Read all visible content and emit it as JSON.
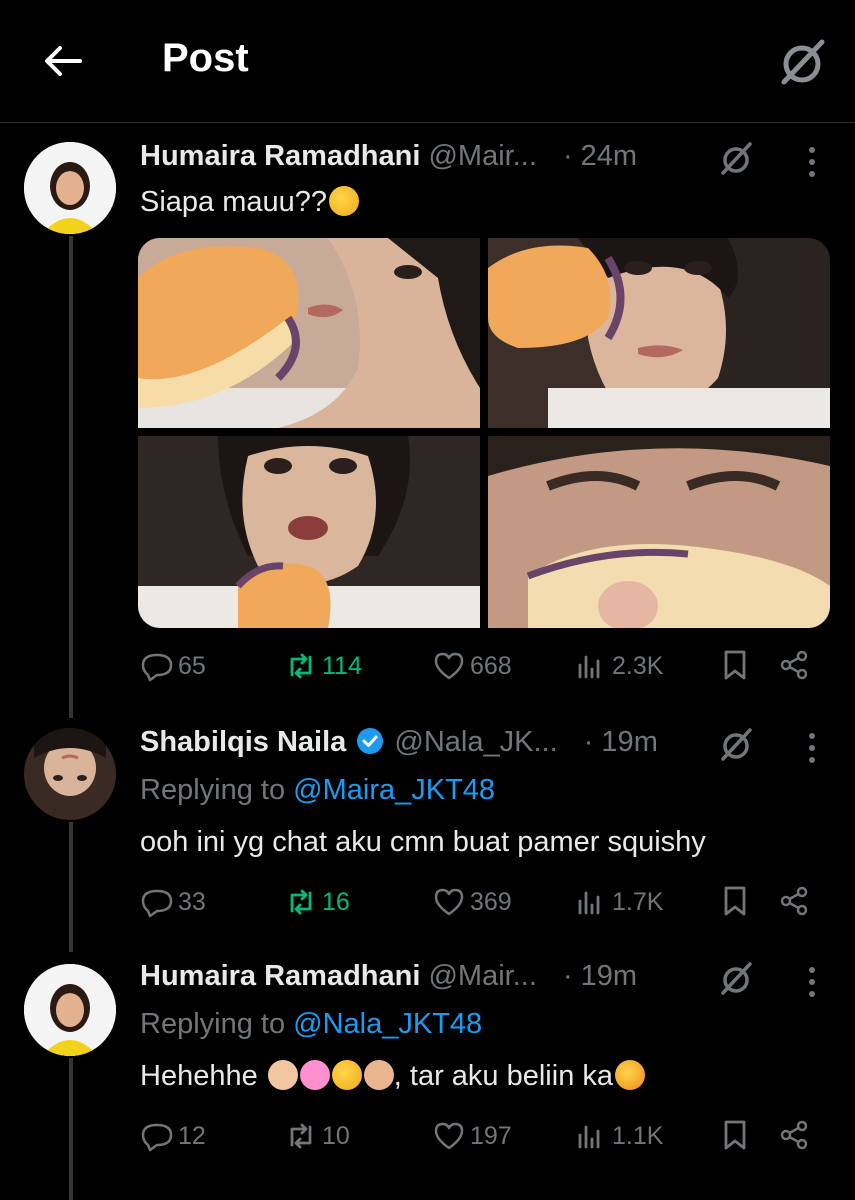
{
  "header": {
    "title": "Post"
  },
  "tweets": [
    {
      "name": "Humaira Ramadhani",
      "handle": "@Mair...",
      "time": "· 24m",
      "text": "Siapa mauu??",
      "replies": "65",
      "reposts": "114",
      "likes": "668",
      "views": "2.3K",
      "reposted": true
    },
    {
      "name": "Shabilqis Naila",
      "handle": "@Nala_JK...",
      "time": "· 19m",
      "replying_prefix": "Replying to ",
      "replying_to": "@Maira_JKT48",
      "text": "ooh ini yg chat aku cmn buat pamer squishy",
      "replies": "33",
      "reposts": "16",
      "likes": "369",
      "views": "1.7K",
      "reposted": true,
      "verified": true
    },
    {
      "name": "Humaira Ramadhani",
      "handle": "@Mair...",
      "time": "· 19m",
      "replying_prefix": "Replying to ",
      "replying_to": "@Nala_JKT48",
      "text": "Hehehhe",
      "text_suffix": ", tar aku beliin  ka",
      "replies": "12",
      "reposts": "10",
      "likes": "197",
      "views": "1.1K",
      "reposted": false
    }
  ],
  "icons": {
    "back": "arrow-left-icon",
    "grok": "grok-icon",
    "reply": "speech-bubble-icon",
    "repost": "repost-icon",
    "like": "heart-icon",
    "views": "bar-chart-icon",
    "bookmark": "bookmark-icon",
    "share": "share-icon"
  },
  "colors": {
    "background": "#000000",
    "text": "#e7e9ea",
    "muted": "#71767b",
    "accent": "#1d9bf0",
    "repost_active": "#00ba7c"
  }
}
